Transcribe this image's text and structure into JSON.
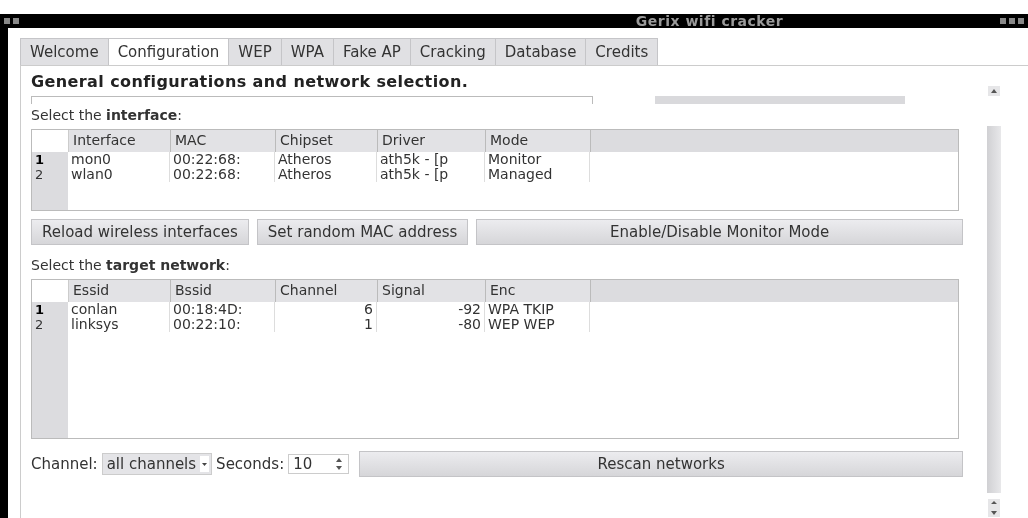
{
  "window": {
    "title": "Gerix wifi cracker"
  },
  "tabs": [
    {
      "label": "Welcome",
      "selected": false
    },
    {
      "label": "Configuration",
      "selected": true
    },
    {
      "label": "WEP",
      "selected": false
    },
    {
      "label": "WPA",
      "selected": false
    },
    {
      "label": "Fake AP",
      "selected": false
    },
    {
      "label": "Cracking",
      "selected": false
    },
    {
      "label": "Database",
      "selected": false
    },
    {
      "label": "Credits",
      "selected": false
    }
  ],
  "heading": "General configurations and network selection.",
  "interface_section": {
    "label": "Select the **interface**:",
    "columns": [
      "Interface",
      "MAC",
      "Chipset",
      "Driver",
      "Mode"
    ],
    "rows": [
      {
        "number": "1",
        "selected": true,
        "cells": [
          "mon0",
          "00:22:68:",
          "Atheros",
          "ath5k - [p",
          "Monitor"
        ]
      },
      {
        "number": "2",
        "selected": false,
        "cells": [
          "wlan0",
          "00:22:68:",
          "Atheros",
          "ath5k - [p",
          "Managed"
        ]
      }
    ],
    "buttons": [
      "Reload wireless interfaces",
      "Set random MAC address",
      "Enable/Disable Monitor Mode"
    ]
  },
  "network_section": {
    "label": "Select the **target network**:",
    "columns": [
      "Essid",
      "Bssid",
      "Channel",
      "Signal",
      "Enc"
    ],
    "rows": [
      {
        "number": "1",
        "selected": true,
        "cells": [
          "conlan",
          "00:18:4D:",
          "6",
          "-92",
          "WPA TKIP"
        ]
      },
      {
        "number": "2",
        "selected": false,
        "cells": [
          "linksys",
          "00:22:10:",
          "1",
          "-80",
          "WEP WEP"
        ]
      }
    ]
  },
  "scan_bar": {
    "channel_label": "Channel:",
    "channel_value": "all channels",
    "seconds_label": "Seconds:",
    "seconds_value": "10",
    "button": "Rescan networks"
  }
}
